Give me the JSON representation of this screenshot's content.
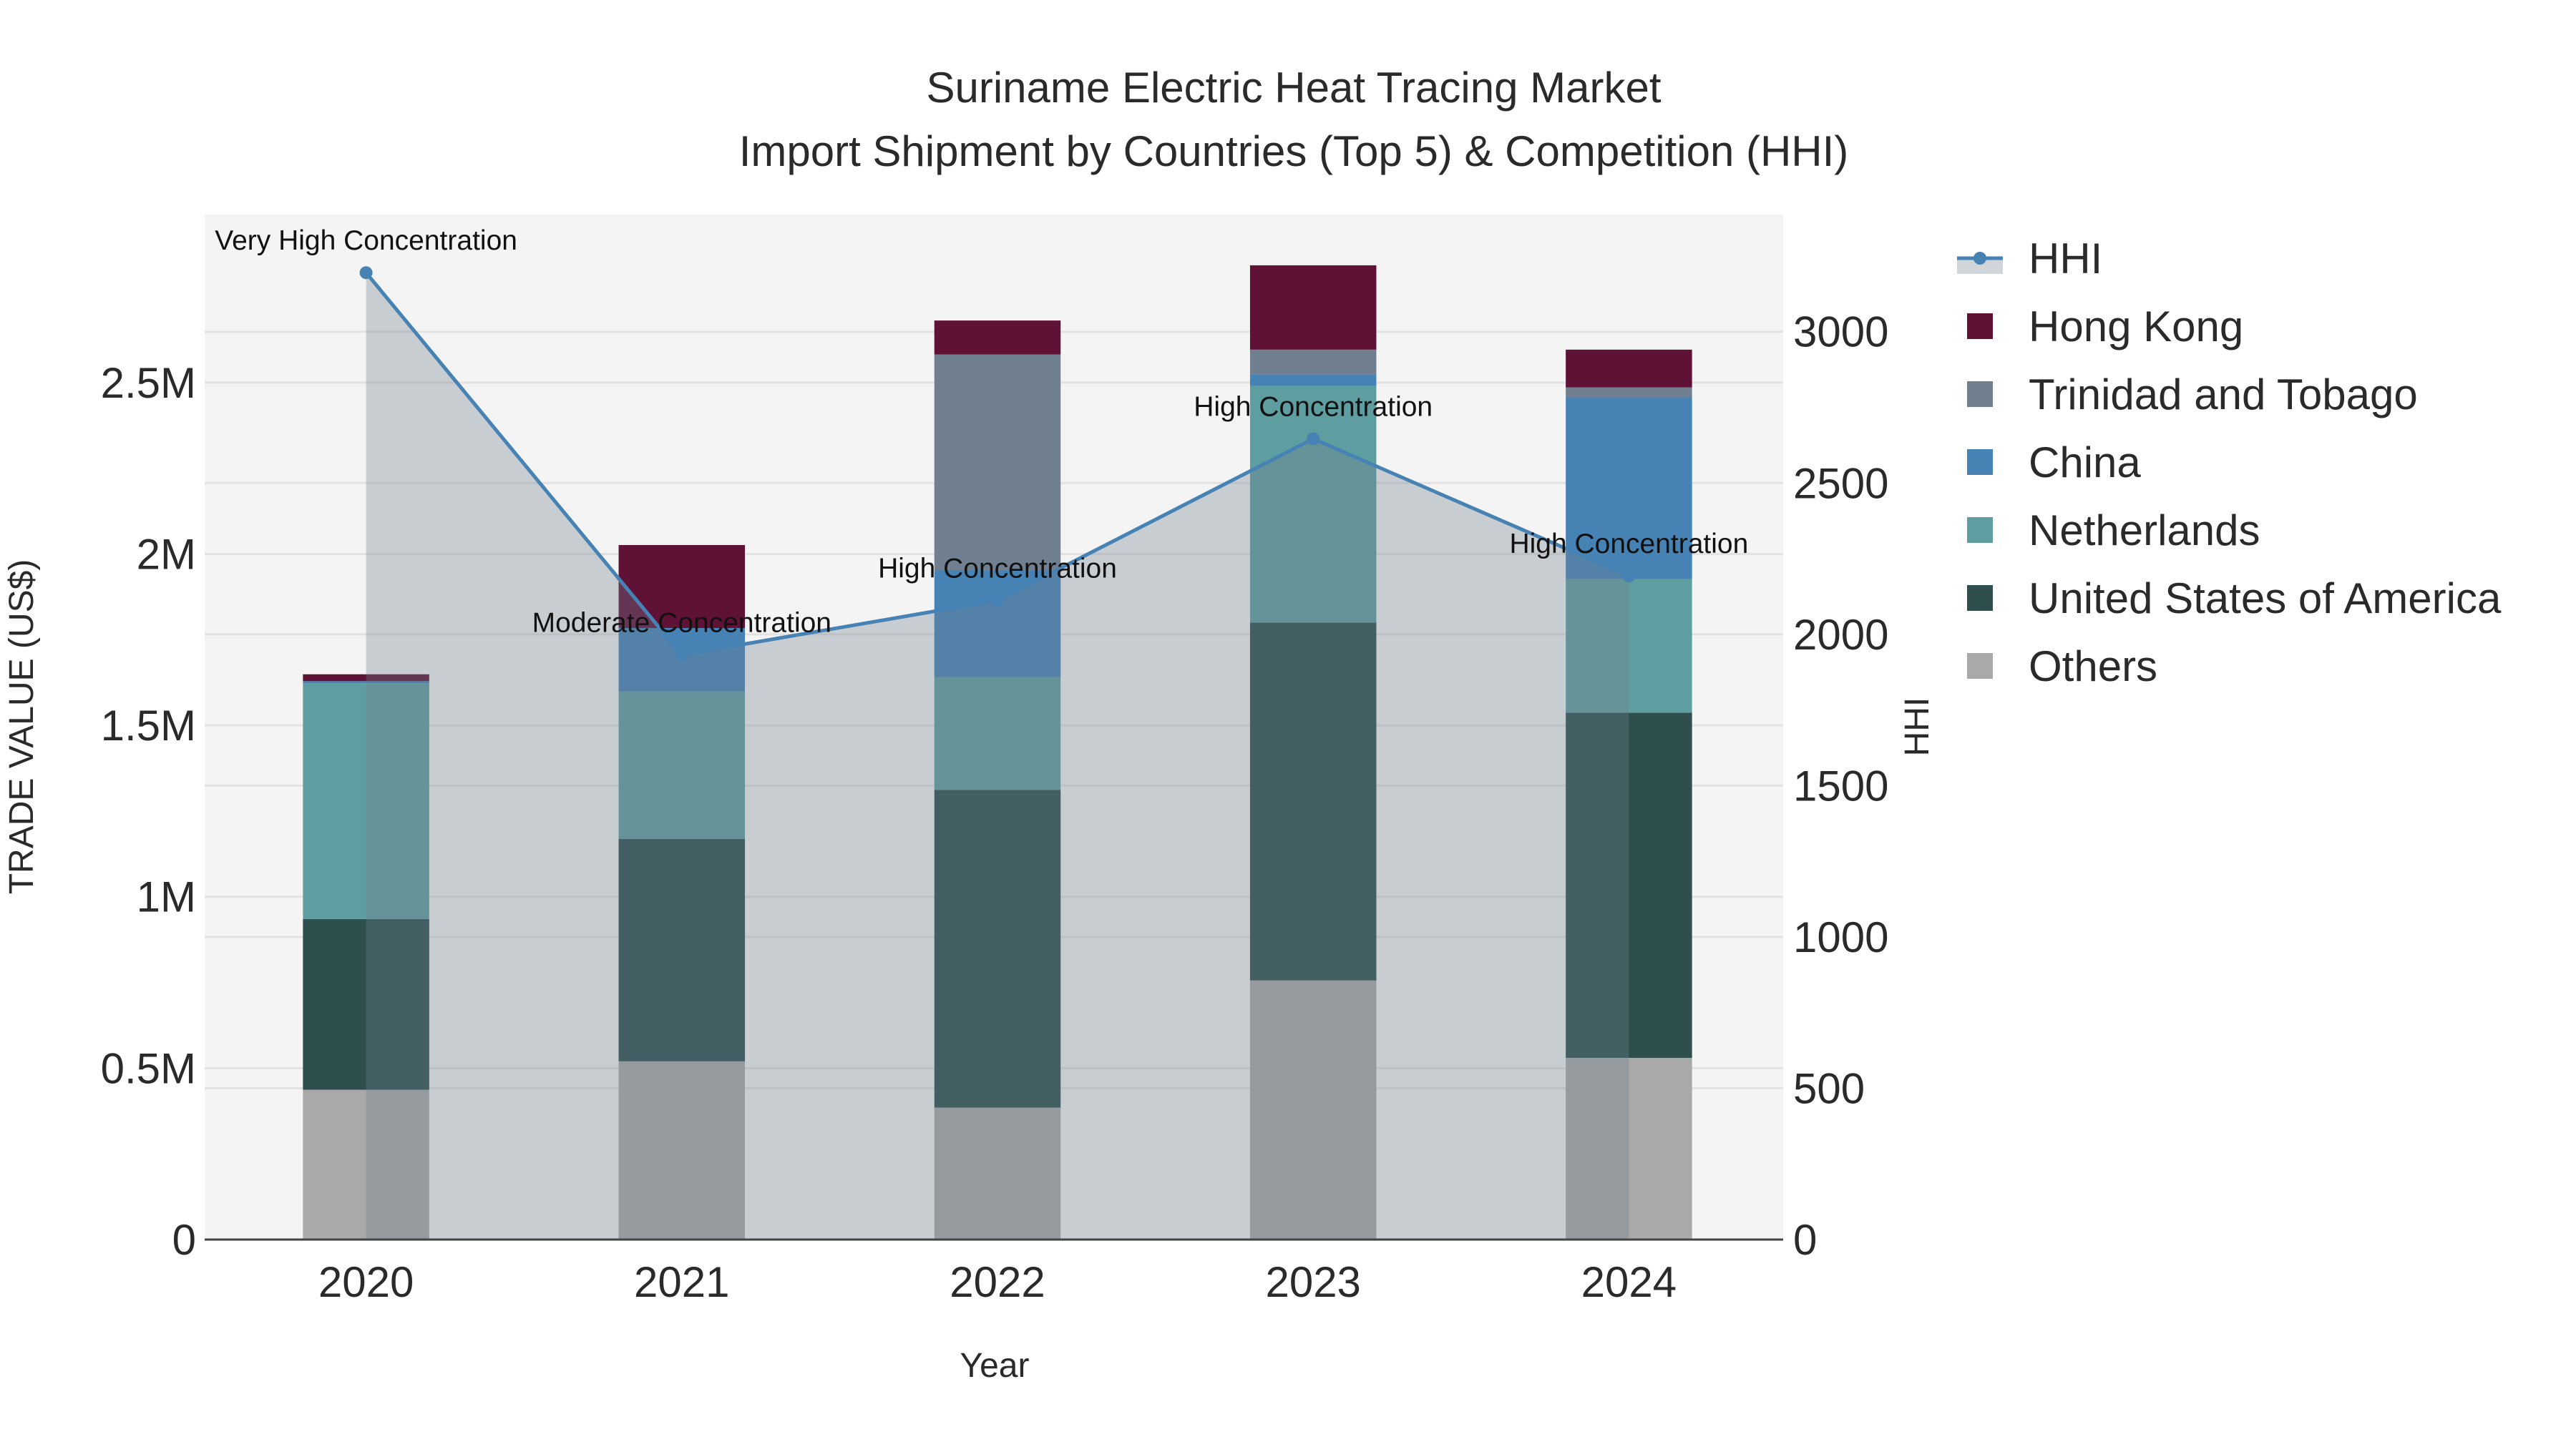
{
  "chart_data": {
    "type": "bar",
    "stacked": true,
    "title": "Suriname Electric Heat Tracing Market",
    "subtitle": "Import Shipment by Countries (Top 5) & Competition (HHI)",
    "xlabel": "Year",
    "ylabel": "TRADE VALUE (US$)",
    "y2label": "HHI",
    "categories": [
      "2020",
      "2021",
      "2022",
      "2023",
      "2024"
    ],
    "ylim": [
      0,
      2990000
    ],
    "y2lim": [
      0,
      3387
    ],
    "yticks": [
      {
        "v": 0,
        "label": "0"
      },
      {
        "v": 500000,
        "label": "0.5M"
      },
      {
        "v": 1000000,
        "label": "1M"
      },
      {
        "v": 1500000,
        "label": "1.5M"
      },
      {
        "v": 2000000,
        "label": "2M"
      },
      {
        "v": 2500000,
        "label": "2.5M"
      }
    ],
    "y2ticks": [
      {
        "v": 0,
        "label": "0"
      },
      {
        "v": 500,
        "label": "500"
      },
      {
        "v": 1000,
        "label": "1000"
      },
      {
        "v": 1500,
        "label": "1500"
      },
      {
        "v": 2000,
        "label": "2000"
      },
      {
        "v": 2500,
        "label": "2500"
      },
      {
        "v": 3000,
        "label": "3000"
      }
    ],
    "grid": true,
    "legend_position": "right",
    "series": [
      {
        "name": "Others",
        "color": "#a9a9a9",
        "values": [
          437000,
          520000,
          385000,
          756000,
          530000
        ]
      },
      {
        "name": "United States of America",
        "color": "#2f4f4f",
        "values": [
          498000,
          649000,
          927000,
          1044000,
          1007000
        ]
      },
      {
        "name": "Netherlands",
        "color": "#5f9ea0",
        "values": [
          688000,
          430000,
          329000,
          690000,
          390000
        ]
      },
      {
        "name": "China",
        "color": "#4682b4",
        "values": [
          6000,
          185000,
          311000,
          34000,
          530000
        ]
      },
      {
        "name": "Trinidad and Tobago",
        "color": "#708090",
        "values": [
          0,
          0,
          630000,
          72000,
          29000
        ]
      },
      {
        "name": "Hong Kong",
        "color": "#601236",
        "values": [
          20000,
          242000,
          99000,
          246000,
          110000
        ]
      }
    ],
    "hhi": {
      "name": "HHI",
      "color": "#4682b4",
      "fill": "rgba(112,128,144,0.33)",
      "values": [
        3195,
        1932,
        2112,
        2646,
        2193
      ],
      "annotations": [
        "Very High Concentration",
        "Moderate Concentration",
        "High Concentration",
        "High Concentration",
        "High Concentration"
      ]
    }
  }
}
